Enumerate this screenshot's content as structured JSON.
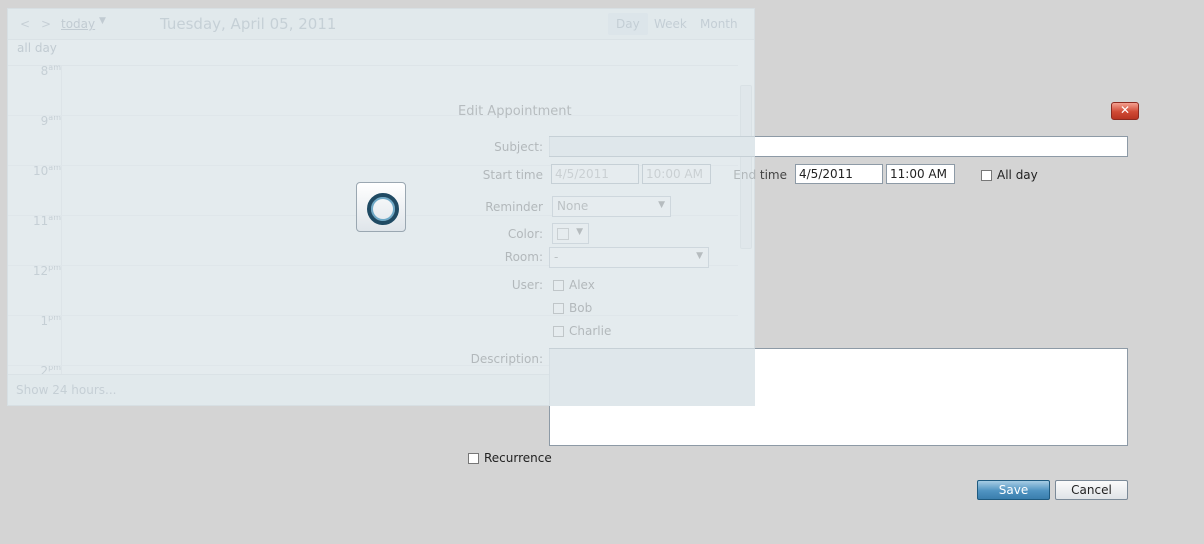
{
  "scheduler": {
    "nav_prev": "<",
    "nav_next": ">",
    "today_label": "today",
    "date_title": "Tuesday, April 05, 2011",
    "views": [
      {
        "label": "Day",
        "active": true
      },
      {
        "label": "Week",
        "active": false
      },
      {
        "label": "Month",
        "active": false
      }
    ],
    "allday_label": "all day",
    "hours": [
      {
        "h": "8",
        "ap": "am"
      },
      {
        "h": "9",
        "ap": "am"
      },
      {
        "h": "10",
        "ap": "am"
      },
      {
        "h": "11",
        "ap": "am"
      },
      {
        "h": "12",
        "ap": "pm"
      },
      {
        "h": "1",
        "ap": "pm"
      },
      {
        "h": "2",
        "ap": "pm"
      }
    ],
    "footer_label": "Show 24 hours..."
  },
  "dialog": {
    "title": "Edit Appointment",
    "close": "✕",
    "subject_label": "Subject:",
    "subject_value": "",
    "start_label": "Start time",
    "start_date": "4/5/2011",
    "start_time": "10:00 AM",
    "end_label": "End time",
    "end_date": "4/5/2011",
    "end_time": "11:00 AM",
    "allday_label": "All day",
    "reminder_label": "Reminder",
    "reminder_value": "None",
    "color_label": "Color:",
    "room_label": "Room:",
    "room_value": "-",
    "user_label": "User:",
    "users": [
      "Alex",
      "Bob",
      "Charlie"
    ],
    "description_label": "Description:",
    "recurrence_label": "Recurrence",
    "save_label": "Save",
    "cancel_label": "Cancel"
  }
}
